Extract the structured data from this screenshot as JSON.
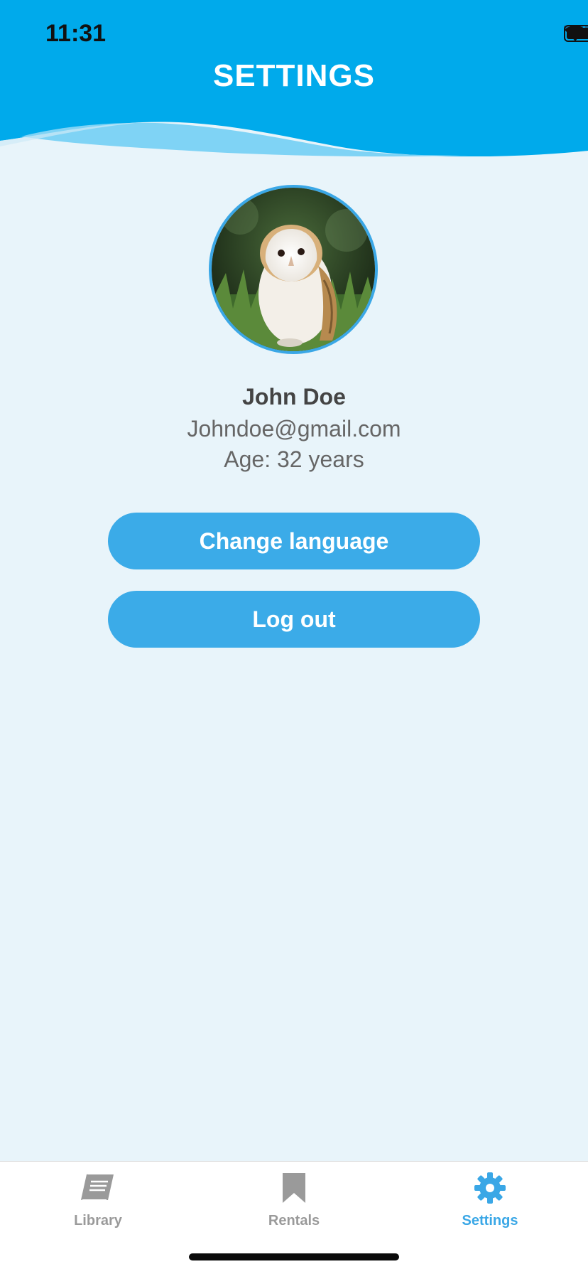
{
  "status_bar": {
    "time": "11:31"
  },
  "header": {
    "title": "SETTINGS",
    "color": "#00aaeb"
  },
  "profile": {
    "name": "John Doe",
    "email": "Johndoe@gmail.com",
    "age": "Age: 32 years"
  },
  "actions": {
    "change_language": "Change language",
    "log_out": "Log out"
  },
  "tabbar": {
    "items": [
      {
        "label": "Library",
        "icon": "book-icon",
        "active": false
      },
      {
        "label": "Rentals",
        "icon": "bookmark-icon",
        "active": false
      },
      {
        "label": "Settings",
        "icon": "gear-icon",
        "active": true
      }
    ],
    "active_color": "#3aa7e6",
    "inactive_color": "#9a9a9a"
  }
}
